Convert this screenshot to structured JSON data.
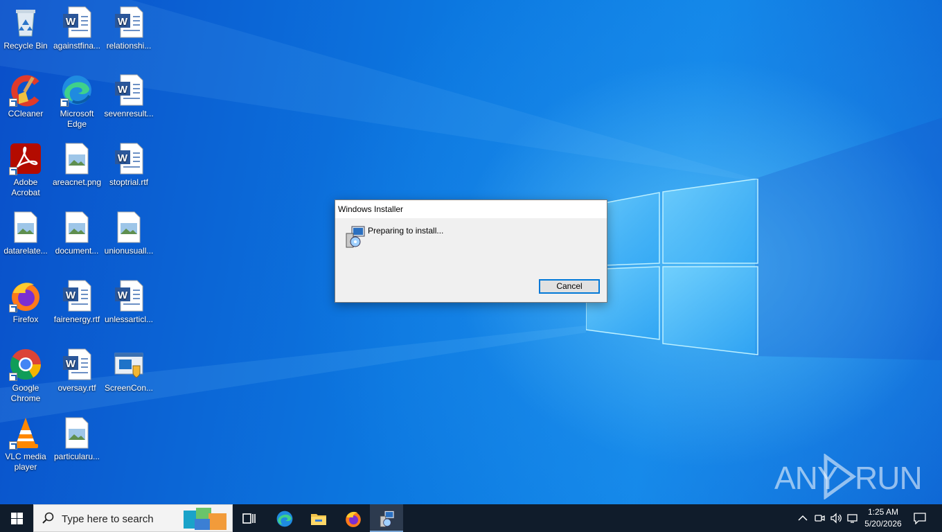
{
  "desktop": {
    "icons": [
      {
        "label": "Recycle Bin",
        "icon": "recycle-bin-icon"
      },
      {
        "label": "againstfina...",
        "icon": "word-doc-icon"
      },
      {
        "label": "relationshi...",
        "icon": "word-doc-icon"
      },
      {
        "label": "CCleaner",
        "icon": "ccleaner-icon"
      },
      {
        "label": "Microsoft Edge",
        "icon": "edge-icon"
      },
      {
        "label": "sevenresult...",
        "icon": "word-doc-icon"
      },
      {
        "label": "Adobe Acrobat",
        "icon": "acrobat-icon"
      },
      {
        "label": "areacnet.png",
        "icon": "image-file-icon"
      },
      {
        "label": "stoptrial.rtf",
        "icon": "word-doc-icon"
      },
      {
        "label": "datarelate...",
        "icon": "image-file-icon"
      },
      {
        "label": "document...",
        "icon": "image-file-icon"
      },
      {
        "label": "unionusuall...",
        "icon": "image-file-icon"
      },
      {
        "label": "Firefox",
        "icon": "firefox-icon"
      },
      {
        "label": "fairenergy.rtf",
        "icon": "word-doc-icon"
      },
      {
        "label": "unlessarticl...",
        "icon": "word-doc-icon"
      },
      {
        "label": "Google Chrome",
        "icon": "chrome-icon"
      },
      {
        "label": "oversay.rtf",
        "icon": "word-doc-icon"
      },
      {
        "label": "ScreenCon...",
        "icon": "screenconnect-icon"
      },
      {
        "label": "VLC media player",
        "icon": "vlc-icon"
      },
      {
        "label": "particularu...",
        "icon": "image-file-icon"
      }
    ]
  },
  "dialog": {
    "title": "Windows Installer",
    "message": "Preparing to install...",
    "cancel_label": "Cancel"
  },
  "watermark": {
    "left": "ANY",
    "right": "RUN"
  },
  "taskbar": {
    "search_placeholder": "Type here to search",
    "pinned": [
      "task-view-icon",
      "edge-icon",
      "file-explorer-icon",
      "firefox-icon",
      "windows-installer-icon"
    ],
    "clock_time": "1:25 AM",
    "clock_date": "5/20/2026"
  },
  "colors": {
    "accent": "#0078d7",
    "taskbar": "#101c2b",
    "desktop": "#0a6fd9"
  }
}
